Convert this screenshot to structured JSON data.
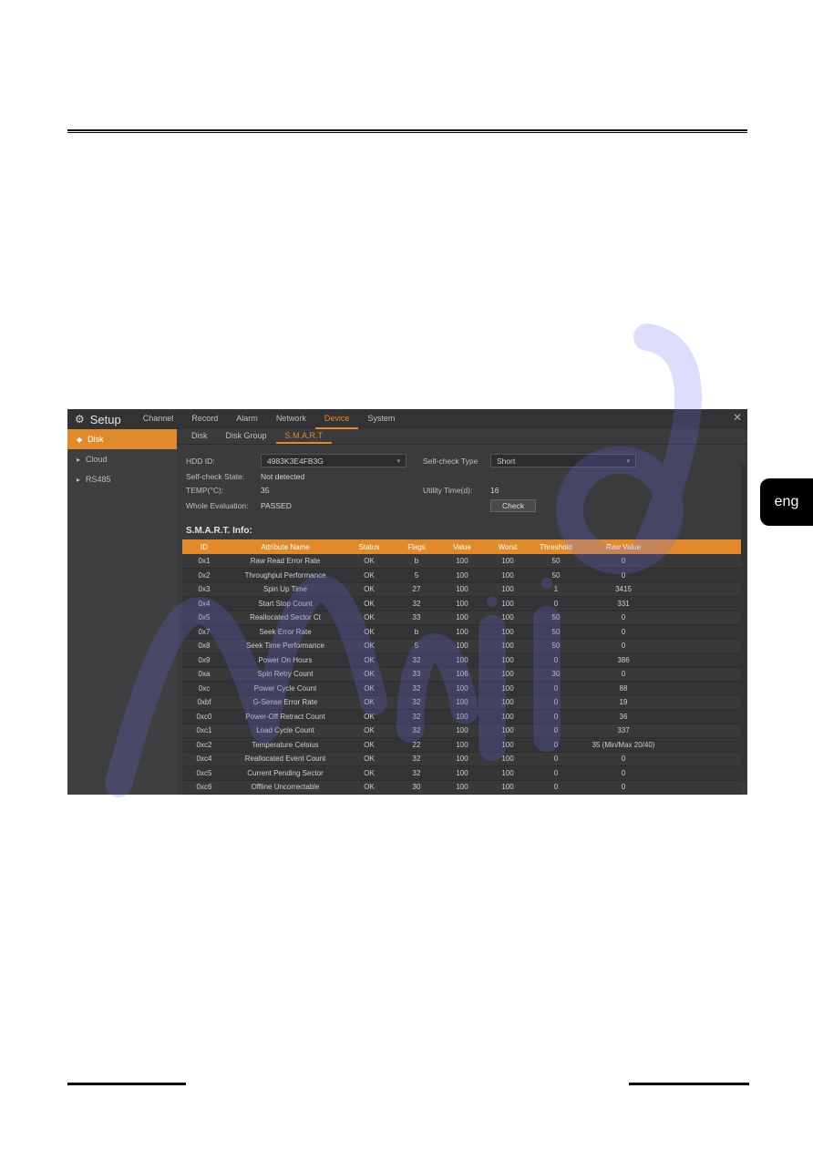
{
  "lang_badge": "eng",
  "window": {
    "title": "Setup",
    "topnav": [
      "Channel",
      "Record",
      "Alarm",
      "Network",
      "Device",
      "System"
    ],
    "topnav_active_index": 4,
    "close_glyph": "✕"
  },
  "sidebar": {
    "items": [
      {
        "label": "Disk",
        "active": true
      },
      {
        "label": "Cloud",
        "active": false
      },
      {
        "label": "RS485",
        "active": false
      }
    ]
  },
  "subtabs": {
    "items": [
      "Disk",
      "Disk Group",
      "S.M.A.R.T"
    ],
    "active_index": 2
  },
  "form": {
    "hdd_id_label": "HDD ID:",
    "hdd_id_value": "4983K3E4FB3G",
    "selfcheck_type_label": "Self-check Type",
    "selfcheck_type_value": "Short",
    "selfcheck_state_label": "Self-check State:",
    "selfcheck_state_value": "Not detected",
    "temp_label": "TEMP(°C):",
    "temp_value": "35",
    "utility_time_label": "Utility Time(d):",
    "utility_time_value": "16",
    "whole_eval_label": "Whole Evaluation:",
    "whole_eval_value": "PASSED",
    "check_button": "Check"
  },
  "smart": {
    "title": "S.M.A.R.T. Info:",
    "headers": [
      "ID",
      "Attribute Name",
      "Status",
      "Flags",
      "Value",
      "Worst",
      "Threshold",
      "Raw Value",
      ""
    ],
    "rows": [
      [
        "0x1",
        "Raw Read Error Rate",
        "OK",
        "b",
        "100",
        "100",
        "50",
        "0",
        ""
      ],
      [
        "0x2",
        "Throughput Performance",
        "OK",
        "5",
        "100",
        "100",
        "50",
        "0",
        ""
      ],
      [
        "0x3",
        "Spin Up Time",
        "OK",
        "27",
        "100",
        "100",
        "1",
        "3415",
        ""
      ],
      [
        "0x4",
        "Start Stop Count",
        "OK",
        "32",
        "100",
        "100",
        "0",
        "331",
        ""
      ],
      [
        "0x5",
        "Reallocated Sector Ct",
        "OK",
        "33",
        "100",
        "100",
        "50",
        "0",
        ""
      ],
      [
        "0x7",
        "Seek Error Rate",
        "OK",
        "b",
        "100",
        "100",
        "50",
        "0",
        ""
      ],
      [
        "0x8",
        "Seek Time Performance",
        "OK",
        "5",
        "100",
        "100",
        "50",
        "0",
        ""
      ],
      [
        "0x9",
        "Power On Hours",
        "OK",
        "32",
        "100",
        "100",
        "0",
        "386",
        ""
      ],
      [
        "0xa",
        "Spin Retry Count",
        "OK",
        "33",
        "106",
        "100",
        "30",
        "0",
        ""
      ],
      [
        "0xc",
        "Power Cycle Count",
        "OK",
        "32",
        "100",
        "100",
        "0",
        "88",
        ""
      ],
      [
        "0xbf",
        "G-Sense Error Rate",
        "OK",
        "32",
        "100",
        "100",
        "0",
        "19",
        ""
      ],
      [
        "0xc0",
        "Power-Off Retract Count",
        "OK",
        "32",
        "100",
        "100",
        "0",
        "36",
        ""
      ],
      [
        "0xc1",
        "Load Cycle Count",
        "OK",
        "32",
        "100",
        "100",
        "0",
        "337",
        ""
      ],
      [
        "0xc2",
        "Temperature Celsius",
        "OK",
        "22",
        "100",
        "100",
        "0",
        "35 (Min/Max 20/40)",
        ""
      ],
      [
        "0xc4",
        "Reallocated Event Count",
        "OK",
        "32",
        "100",
        "100",
        "0",
        "0",
        ""
      ],
      [
        "0xc5",
        "Current Pending Sector",
        "OK",
        "32",
        "100",
        "100",
        "0",
        "0",
        ""
      ],
      [
        "0xc6",
        "Offline Uncorrectable",
        "OK",
        "30",
        "100",
        "100",
        "0",
        "0",
        ""
      ]
    ]
  }
}
